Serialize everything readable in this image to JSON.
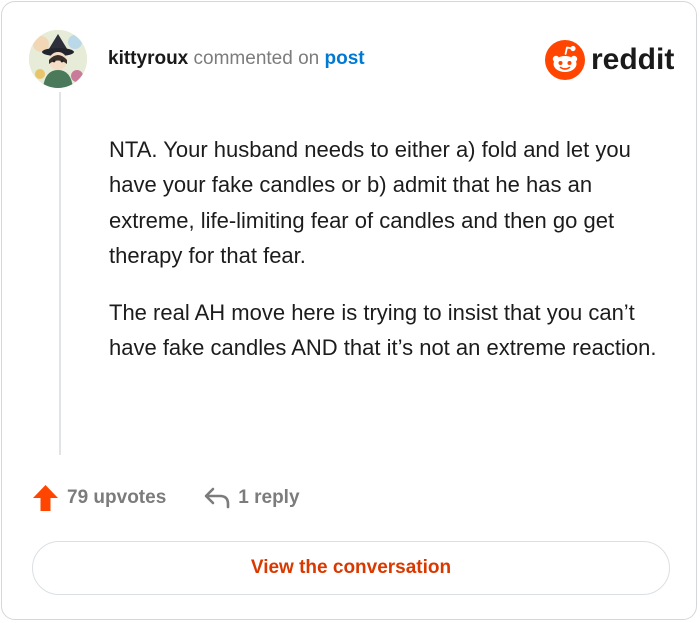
{
  "comment": {
    "username": "kittyroux",
    "action_text": "commented on",
    "post_link": "post",
    "paragraphs": [
      "NTA. Your husband needs to either a) fold and let you have your fake candles or b) admit that he has an extreme, life-limiting fear of candles and then go get therapy for that fear.",
      "The real AH move here is trying to insist that you can’t have fake candles AND that it’s not an extreme reaction."
    ]
  },
  "brand": {
    "name": "reddit",
    "accent_color": "#ff4500"
  },
  "stats": {
    "upvotes": "79 upvotes",
    "replies": "1 reply"
  },
  "cta": {
    "label": "View the conversation"
  },
  "icons": {
    "upvote": "upvote-arrow-icon",
    "reply": "reply-arrow-icon",
    "logo": "reddit-alien-icon"
  }
}
